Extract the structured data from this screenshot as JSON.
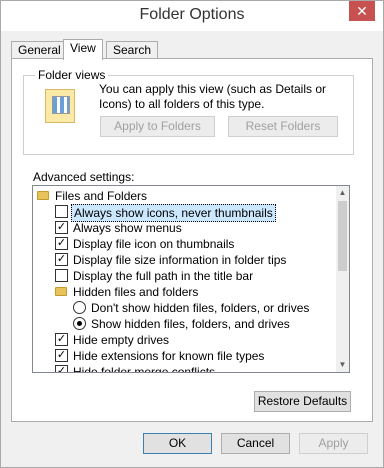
{
  "window": {
    "title": "Folder Options",
    "close_glyph": "✕"
  },
  "tabs": [
    {
      "label": "General"
    },
    {
      "label": "View"
    },
    {
      "label": "Search"
    }
  ],
  "folder_views": {
    "legend": "Folder views",
    "description": "You can apply this view (such as Details or Icons) to all folders of this type.",
    "apply_label": "Apply to Folders",
    "reset_label": "Reset Folders"
  },
  "advanced": {
    "label": "Advanced settings:",
    "items": [
      {
        "type": "folder",
        "label": "Files and Folders"
      },
      {
        "type": "checkbox",
        "checked": false,
        "label": "Always show icons, never thumbnails"
      },
      {
        "type": "checkbox",
        "checked": true,
        "label": "Always show menus"
      },
      {
        "type": "checkbox",
        "checked": true,
        "label": "Display file icon on thumbnails"
      },
      {
        "type": "checkbox",
        "checked": true,
        "label": "Display file size information in folder tips"
      },
      {
        "type": "checkbox",
        "checked": false,
        "label": "Display the full path in the title bar"
      },
      {
        "type": "folder",
        "label": "Hidden files and folders"
      },
      {
        "type": "radio",
        "checked": false,
        "label": "Don't show hidden files, folders, or drives"
      },
      {
        "type": "radio",
        "checked": true,
        "label": "Show hidden files, folders, and drives"
      },
      {
        "type": "checkbox",
        "checked": true,
        "label": "Hide empty drives"
      },
      {
        "type": "checkbox",
        "checked": true,
        "label": "Hide extensions for known file types"
      },
      {
        "type": "checkbox",
        "checked": true,
        "label": "Hide folder merge conflicts"
      }
    ],
    "check_glyph": "✓"
  },
  "buttons": {
    "restore_defaults": "Restore Defaults",
    "ok": "OK",
    "cancel": "Cancel",
    "apply": "Apply"
  }
}
